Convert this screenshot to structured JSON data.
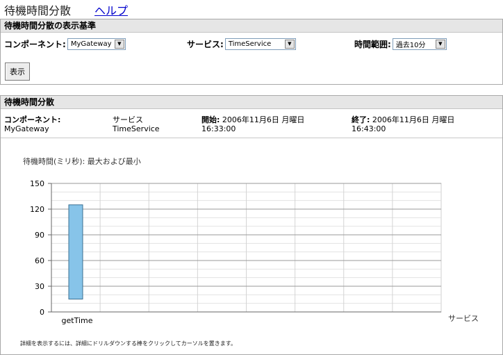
{
  "page": {
    "title": "待機時間分散",
    "help_link": "ヘルプ"
  },
  "criteria": {
    "header": "待機時間分散の表示基準",
    "component_label": "コンポーネント:",
    "component_value": "MyGateway",
    "service_label": "サービス:",
    "service_value": "TimeService",
    "time_range_label": "時間範囲:",
    "time_range_value": "過去10分",
    "show_button": "表示"
  },
  "results": {
    "header": "待機時間分散",
    "component_label": "コンポーネント:",
    "component_value": "MyGateway",
    "service_label": "サービス",
    "service_value": "TimeService",
    "start_label": "開始:",
    "start_date": "2006年11月6日 月曜日",
    "start_time": "16:33:00",
    "end_label": "終了:",
    "end_date": "2006年11月6日 月曜日",
    "end_time": "16:43:00",
    "footnote": "詳細を表示するには、詳細にドリルダウンする棒をクリックしてカーソルを置きます。"
  },
  "chart_data": {
    "type": "bar",
    "title": "待機時間(ミリ秒): 最大および最小",
    "xlabel": "サービス",
    "categories": [
      "getTime"
    ],
    "series": [
      {
        "min": [
          15
        ],
        "max": [
          125
        ]
      }
    ],
    "ylim": [
      0,
      150
    ],
    "yticks": [
      0,
      30,
      60,
      90,
      120,
      150
    ],
    "grid": true,
    "bar_color": "#87c4e9"
  }
}
